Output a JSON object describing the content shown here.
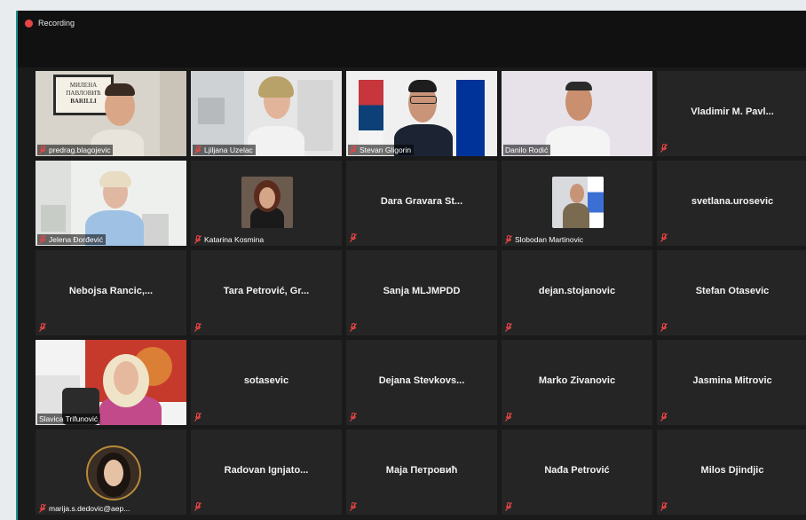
{
  "recording": {
    "label": "Recording"
  },
  "colors": {
    "recording": "#e64545",
    "active_speaker": "#cde37a",
    "tile_bg": "#252525"
  },
  "participants": [
    {
      "name": "predrag.blagojevic",
      "video": true,
      "muted": true
    },
    {
      "name": "Ljiljana Uzelac",
      "video": true,
      "muted": true
    },
    {
      "name": "Stevan Gligorin",
      "video": true,
      "muted": true
    },
    {
      "name": "Danilo Rodić",
      "video": true,
      "muted": false,
      "active": true
    },
    {
      "name": "Vladimir M. Pavl...",
      "video": false,
      "muted": true
    },
    {
      "name": "Jelena Đorđević",
      "video": true,
      "muted": true
    },
    {
      "name": "Katarina Kosmina",
      "video": false,
      "avatar": true,
      "muted": true
    },
    {
      "name": "Dara Gravara St...",
      "video": false,
      "muted": true
    },
    {
      "name": "Slobodan Martinovic",
      "video": false,
      "avatar": true,
      "muted": true
    },
    {
      "name": "svetlana.urosevic",
      "video": false,
      "muted": true
    },
    {
      "name": "Nebojsa Rancic,...",
      "video": false,
      "muted": true
    },
    {
      "name": "Tara Petrović, Gr...",
      "video": false,
      "muted": true
    },
    {
      "name": "Sanja MLJMPDD",
      "video": false,
      "muted": true
    },
    {
      "name": "dejan.stojanovic",
      "video": false,
      "muted": true
    },
    {
      "name": "Stefan Otasevic",
      "video": false,
      "muted": true
    },
    {
      "name": "Slavica Trifunović",
      "video": true,
      "muted": false
    },
    {
      "name": "sotasevic",
      "video": false,
      "muted": true
    },
    {
      "name": "Dejana Stevkovs...",
      "video": false,
      "muted": true
    },
    {
      "name": "Marko Zivanovic",
      "video": false,
      "muted": true
    },
    {
      "name": "Jasmina Mitrovic",
      "video": false,
      "muted": true
    },
    {
      "name": "marija.s.dedovic@aep...",
      "video": false,
      "avatar": true,
      "muted": true
    },
    {
      "name": "Radovan Ignjato...",
      "video": false,
      "muted": true
    },
    {
      "name": "Маја Петровић",
      "video": false,
      "muted": true
    },
    {
      "name": "Nađa Petrović",
      "video": false,
      "muted": true
    },
    {
      "name": "Milos Djindjic",
      "video": false,
      "muted": true
    }
  ],
  "poster_text": {
    "line1": "МИЛЕНА",
    "line2": "ПАВЛОВИЋ",
    "line3": "BARILLI"
  }
}
